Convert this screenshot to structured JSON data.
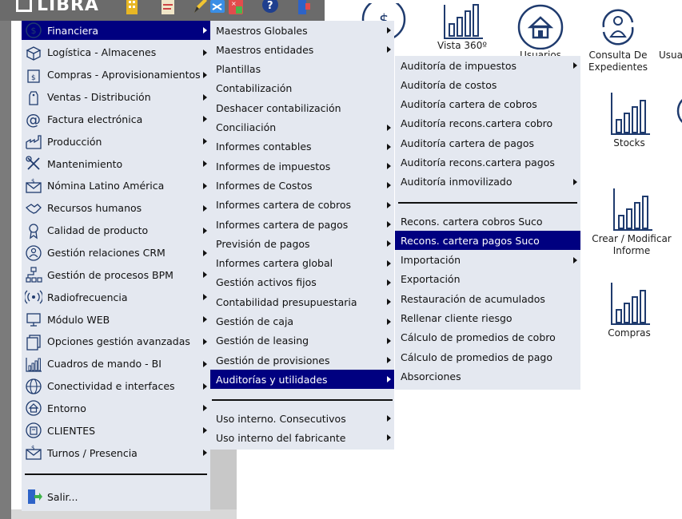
{
  "app": {
    "logo_text": "LIBRA"
  },
  "main_menu": [
    {
      "label": "Financiera",
      "icon": "dollar-circle-icon",
      "selected": true
    },
    {
      "label": "Logística - Almacenes",
      "icon": "boxes-icon"
    },
    {
      "label": "Compras - Aprovisionamientos",
      "icon": "money-bag-icon"
    },
    {
      "label": "Ventas - Distribución",
      "icon": "price-tag-icon"
    },
    {
      "label": "Factura electrónica",
      "icon": "at-sign-icon"
    },
    {
      "label": "Producción",
      "icon": "factory-icon"
    },
    {
      "label": "Mantenimiento",
      "icon": "wrench-screwdriver-icon"
    },
    {
      "label": "Nómina Latino América",
      "icon": "envelope-dollar-icon"
    },
    {
      "label": "Recursos humanos",
      "icon": "handshake-icon"
    },
    {
      "label": "Calidad de producto",
      "icon": "award-ribbon-icon"
    },
    {
      "label": "Gestión relaciones CRM",
      "icon": "crm-person-icon"
    },
    {
      "label": "Gestión de procesos BPM",
      "icon": "process-tree-icon"
    },
    {
      "label": "Radiofrecuencia",
      "icon": "radio-waves-icon"
    },
    {
      "label": "Módulo WEB",
      "icon": "monitor-icon"
    },
    {
      "label": "Opciones gestión avanzadas",
      "icon": "documents-icon"
    },
    {
      "label": "Cuadros de mando - BI",
      "icon": "bar-chart-icon"
    },
    {
      "label": "Conectividad e interfaces",
      "icon": "globe-icon"
    },
    {
      "label": "Entorno",
      "icon": "home-circle-icon"
    },
    {
      "label": "CLIENTES",
      "icon": "building-circle-icon"
    },
    {
      "label": "Turnos / Presencia",
      "icon": "envelope-dollar-icon"
    }
  ],
  "exit_label": "Salir...",
  "financiera_menu": [
    "Maestros Globales",
    "Maestros entidades",
    "Plantillas",
    "Contabilización",
    "Deshacer contabilización",
    "Conciliación",
    "Informes contables",
    "Informes de impuestos",
    "Informes de Costos",
    "Informes cartera de cobros",
    "Informes cartera de pagos",
    "Previsión de pagos",
    "Informes cartera global",
    "Gestión activos fijos",
    "Contabilidad presupuestaria",
    "Gestión de caja",
    "Gestión de leasing",
    "Gestión de provisiones",
    "Auditorías y utilidades"
  ],
  "financiera_menu_extra": [
    "Uso interno. Consecutivos",
    "Uso interno del fabricante"
  ],
  "auditorias_menu_top": [
    "Auditoría de impuestos",
    "Auditoría de costos",
    "Auditoría cartera de cobros",
    "Auditoría recons.cartera cobro",
    "Auditoría cartera de pagos",
    "Auditoría recons.cartera pagos",
    "Auditoría inmovilizado"
  ],
  "auditorias_menu_bottom": [
    "Recons. cartera cobros Suco",
    "Recons. cartera pagos Suco",
    "Importación",
    "Exportación",
    "Restauración de acumulados",
    "Rellenar cliente riesgo",
    "Cálculo de promedios de cobro",
    "Cálculo de promedios de pago",
    "Absorciones"
  ],
  "desktop_tiles": {
    "vista": "Vista 360º",
    "usuarios": "Usuarios",
    "consulta_line1": "Consulta De",
    "consulta_line2": "Expedientes",
    "usua_partial": "Usua",
    "stocks": "Stocks",
    "crear_line1": "Crear / Modificar",
    "crear_line2": "Informe",
    "compras": "Compras"
  },
  "colors": {
    "selection": "#000080",
    "menu_bg": "#e4e8f0",
    "icon_blue": "#1f3b6e"
  }
}
